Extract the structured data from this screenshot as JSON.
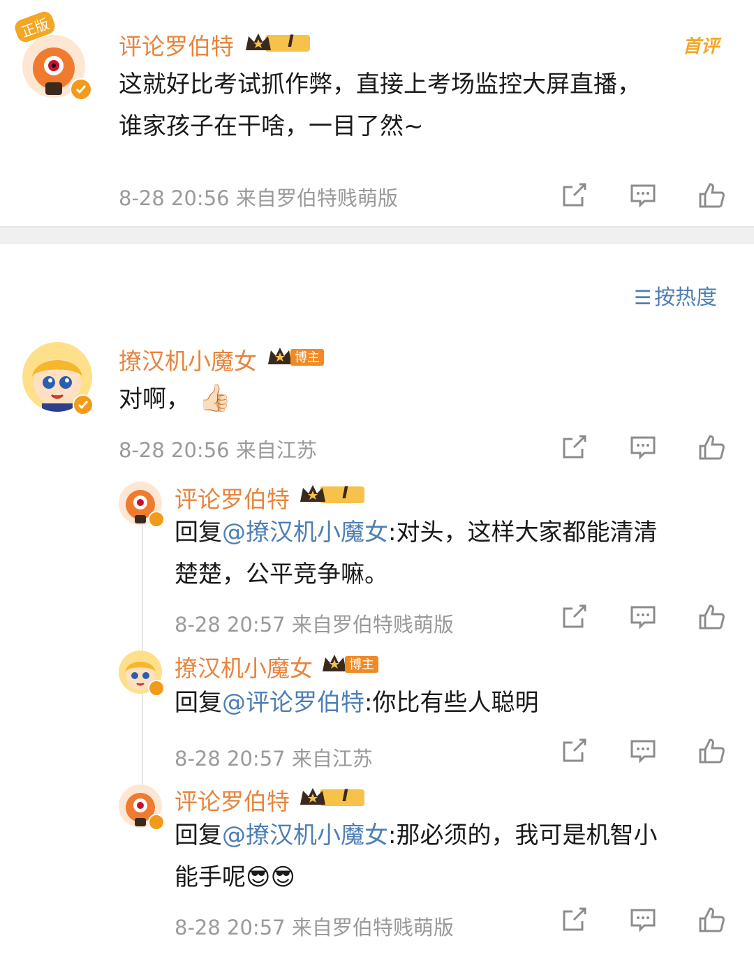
{
  "top_comment": {
    "author": "评论罗伯特",
    "level_badge": "I",
    "corner_tag": "首评",
    "avatar_tag": "正版",
    "text_line1": "这就好比考试抓作弊，直接上考场监控大屏直播，",
    "text_line2": "谁家孩子在干啥，一目了然~",
    "meta": "8-28 20:56  来自罗伯特贱萌版"
  },
  "sort": {
    "label": "按热度"
  },
  "comment2": {
    "author": "撩汉机小魔女",
    "badge": "博主",
    "text": "对啊，",
    "meta": "8-28 20:56  来自江苏"
  },
  "replies": [
    {
      "author": "评论罗伯特",
      "level_badge": "I",
      "prefix": "回复",
      "mention": "@撩汉机小魔女",
      "text_line1": ":对头，这样大家都能清清",
      "text_line2": "楚楚，公平竞争嘛。",
      "meta": "8-28 20:57  来自罗伯特贱萌版"
    },
    {
      "author": "撩汉机小魔女",
      "badge": "博主",
      "prefix": "回复",
      "mention": "@评论罗伯特",
      "text_line1": ":你比有些人聪明",
      "meta": "8-28 20:57  来自江苏"
    },
    {
      "author": "评论罗伯特",
      "level_badge": "I",
      "prefix": "回复",
      "mention": "@撩汉机小魔女",
      "text_line1": ":那必须的，我可是机智小",
      "text_line2": "能手呢",
      "meta": "8-28 20:57  来自罗伯特贱萌版"
    }
  ],
  "colors": {
    "username": "#e8843c",
    "mention": "#4d7fb5",
    "meta": "#9a9a9a",
    "icon": "#8c8c8c"
  },
  "icons": [
    "share-icon",
    "comment-icon",
    "like-icon",
    "verified-icon",
    "crown-icon",
    "thumbs-up-emoji",
    "sunglasses-emoji"
  ]
}
